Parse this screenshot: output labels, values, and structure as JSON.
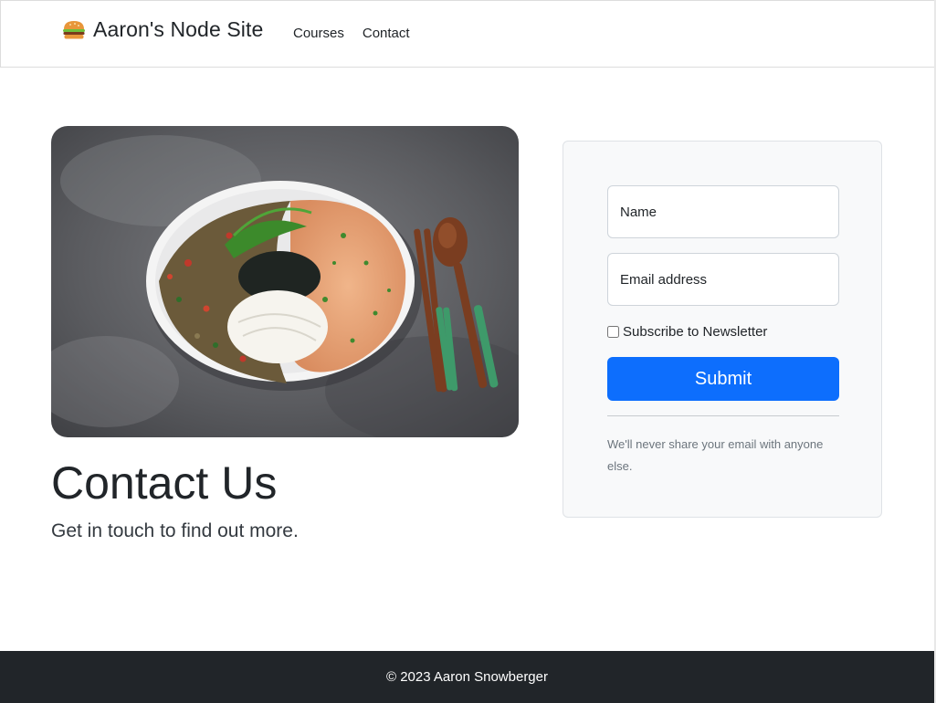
{
  "brand": {
    "icon": "hamburger-icon",
    "name": "Aaron's Node Site"
  },
  "nav": {
    "links": [
      {
        "label": "Courses"
      },
      {
        "label": "Contact"
      }
    ]
  },
  "hero": {
    "image": "food-plate-image",
    "title": "Contact Us",
    "subtitle": "Get in touch to find out more."
  },
  "form": {
    "name_placeholder": "Name",
    "email_placeholder": "Email address",
    "subscribe_label": "Subscribe to Newsletter",
    "subscribe_checked": false,
    "submit_label": "Submit",
    "privacy_note": "We'll never share your email with anyone else."
  },
  "footer": {
    "text": "© 2023 Aaron Snowberger"
  },
  "colors": {
    "primary": "#0d6efd",
    "footer_bg": "#212529",
    "card_bg": "#f8f9fa"
  }
}
